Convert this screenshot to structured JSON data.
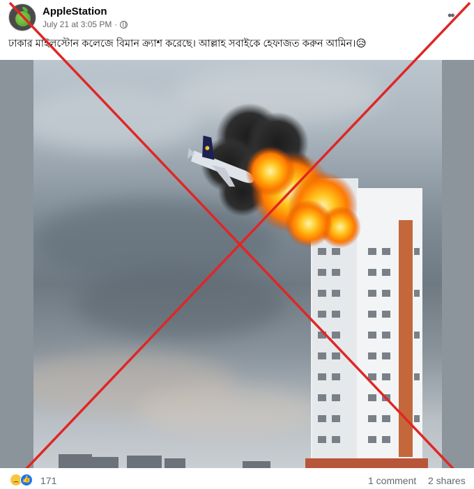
{
  "post": {
    "page_name": "AppleStation",
    "timestamp": "July 21 at 3:05 PM",
    "separator": "·",
    "privacy_icon": "globe-icon",
    "more_icon": "more-options-icon",
    "caption": "ঢাকার মাইলস্টোন কলেজে বিমান ক্র্যাশ করেছে। আল্লাহ সবাইকে হেফাজত করুন আমিন।😥"
  },
  "image": {
    "description_icon": "photo",
    "overlay": "red-x",
    "overlay_color": "#e02626"
  },
  "footer": {
    "reaction_icons": [
      "sad-reaction-icon",
      "like-reaction-icon"
    ],
    "reaction_count": "171",
    "comments": "1 comment",
    "shares": "2 shares"
  },
  "colors": {
    "text_primary": "#050505",
    "text_secondary": "#65676b",
    "like_blue": "#1877f2"
  }
}
